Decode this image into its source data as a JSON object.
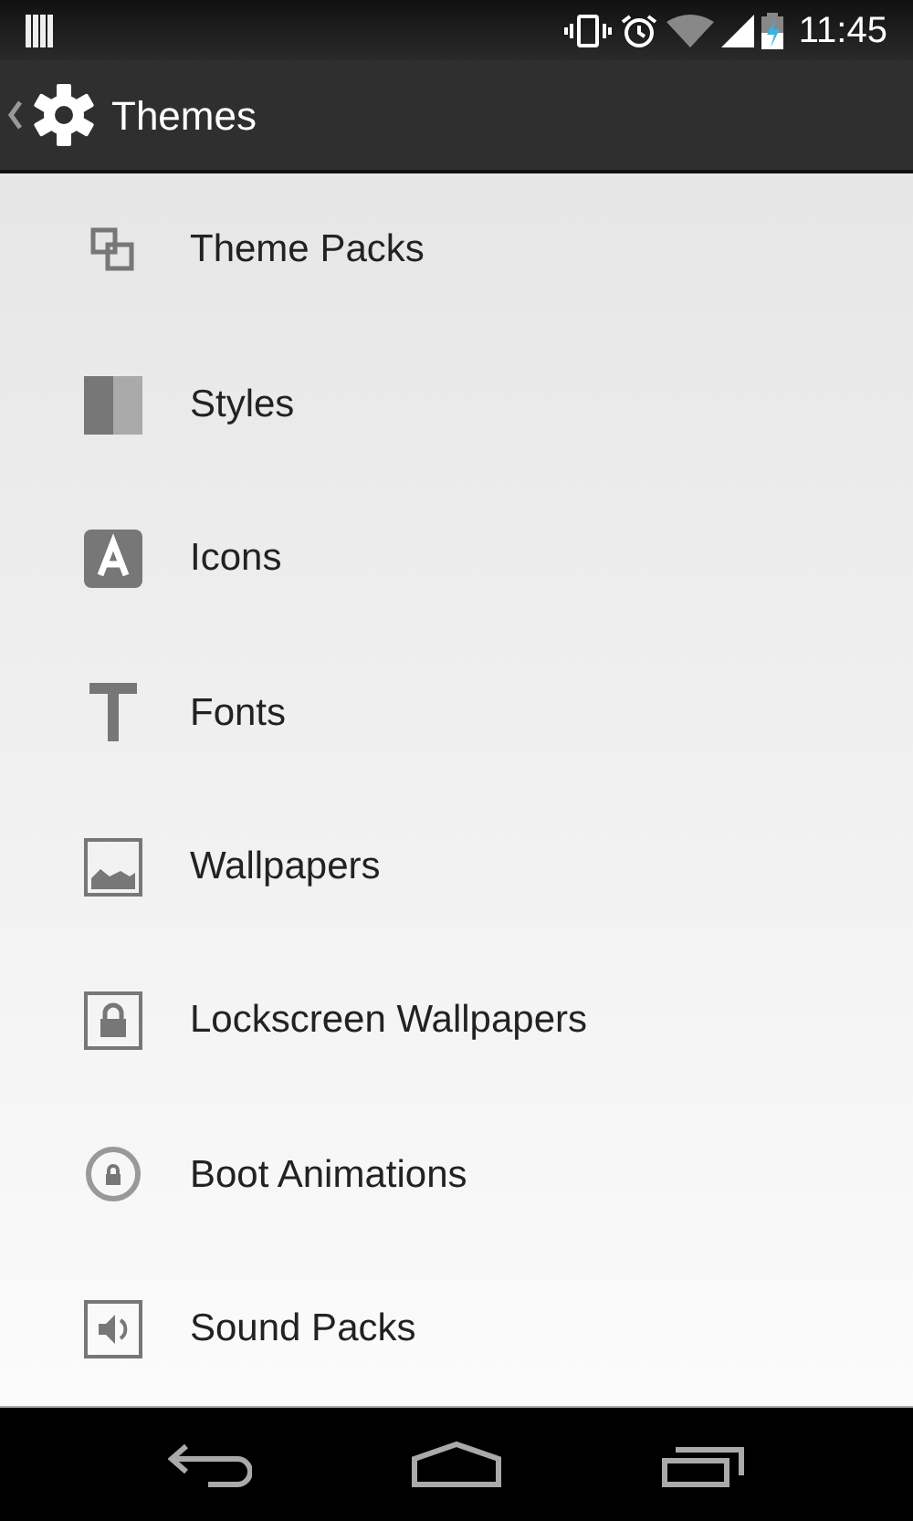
{
  "status_bar": {
    "time": "11:45"
  },
  "action_bar": {
    "title": "Themes"
  },
  "items": [
    {
      "label": "Theme Packs",
      "kind": "packs"
    },
    {
      "label": "Styles",
      "kind": "styles"
    },
    {
      "label": "Icons",
      "kind": "icons"
    },
    {
      "label": "Fonts",
      "kind": "fonts"
    },
    {
      "label": "Wallpapers",
      "kind": "wallpapers"
    },
    {
      "label": "Lockscreen Wallpapers",
      "kind": "lockscreen"
    },
    {
      "label": "Boot Animations",
      "kind": "boot"
    },
    {
      "label": "Sound Packs",
      "kind": "sounds"
    }
  ]
}
